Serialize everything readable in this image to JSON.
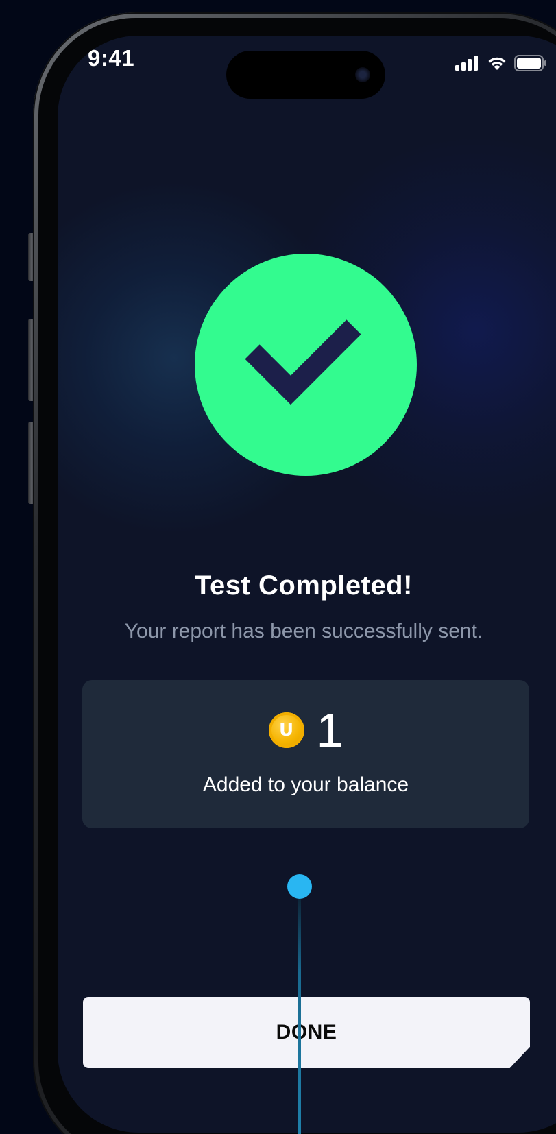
{
  "status_bar": {
    "time": "9:41",
    "signal_icon": "cellular-signal-icon",
    "wifi_icon": "wifi-icon",
    "battery_icon": "battery-icon"
  },
  "success": {
    "icon": "checkmark-icon",
    "color": "#33fb8f",
    "title": "Test Completed!",
    "subtitle": "Your report has been successfully sent."
  },
  "reward": {
    "coin_icon": "coin-icon",
    "coin_letter": "U",
    "amount": "1",
    "caption": "Added to your balance"
  },
  "actions": {
    "done_label": "DONE"
  },
  "colors": {
    "background": "#0e1428",
    "card": "#1f2a3a",
    "button": "#f3f3f9",
    "pointer": "#29b6f2"
  }
}
